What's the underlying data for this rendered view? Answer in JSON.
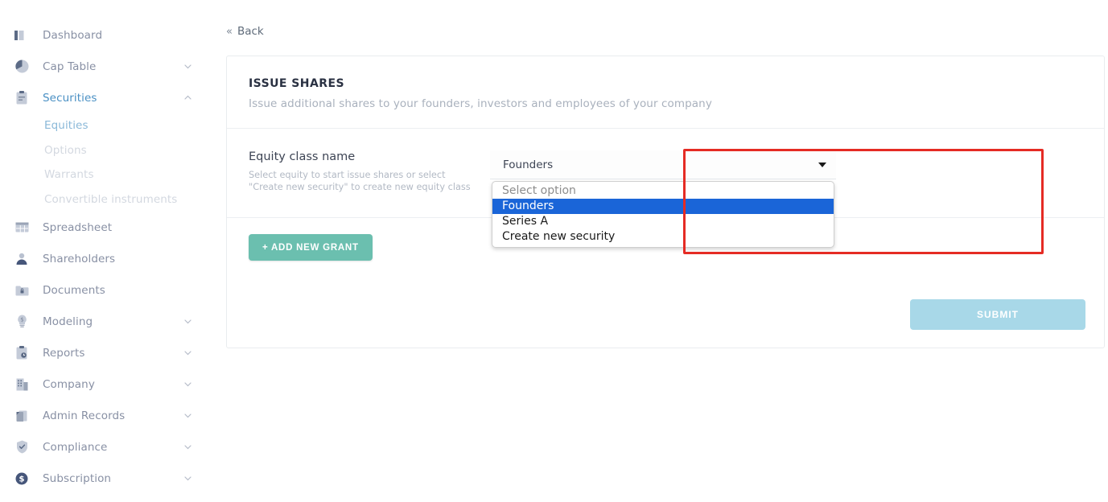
{
  "sidebar": {
    "items": [
      {
        "label": "Dashboard",
        "icon": "bar-chart-icon",
        "expandable": false,
        "active": false
      },
      {
        "label": "Cap Table",
        "icon": "pie-chart-icon",
        "expandable": true,
        "active": false
      },
      {
        "label": "Securities",
        "icon": "clipboard-icon",
        "expandable": true,
        "active": true
      },
      {
        "label": "Spreadsheet",
        "icon": "table-grid-icon",
        "expandable": false,
        "active": false
      },
      {
        "label": "Shareholders",
        "icon": "person-icon",
        "expandable": false,
        "active": false
      },
      {
        "label": "Documents",
        "icon": "locked-folder-icon",
        "expandable": false,
        "active": false
      },
      {
        "label": "Modeling",
        "icon": "lightbulb-dollar-icon",
        "expandable": true,
        "active": false
      },
      {
        "label": "Reports",
        "icon": "clipboard-clock-icon",
        "expandable": true,
        "active": false
      },
      {
        "label": "Company",
        "icon": "building-icon",
        "expandable": true,
        "active": false
      },
      {
        "label": "Admin Records",
        "icon": "documents-icon",
        "expandable": true,
        "active": false
      },
      {
        "label": "Compliance",
        "icon": "shield-check-icon",
        "expandable": true,
        "active": false
      },
      {
        "label": "Subscription",
        "icon": "dollar-circle-icon",
        "expandable": true,
        "active": false
      }
    ],
    "securities_subitems": [
      {
        "label": "Equities",
        "selected": true
      },
      {
        "label": "Options",
        "selected": false
      },
      {
        "label": "Warrants",
        "selected": false
      },
      {
        "label": "Convertible instruments",
        "selected": false
      }
    ]
  },
  "main": {
    "back_label": "Back",
    "back_chevron": "«",
    "header": {
      "title": "ISSUE SHARES",
      "subtitle": "Issue additional shares to your founders, investors and employees of your company"
    },
    "field": {
      "title": "Equity class name",
      "help_line1": "Select equity to start issue shares or select",
      "help_line2": "\"Create new security\" to create new equity class",
      "selected_value": "Founders",
      "options": [
        {
          "label": "Select option",
          "state": "placeholder"
        },
        {
          "label": "Founders",
          "state": "highlighted"
        },
        {
          "label": "Series A",
          "state": "normal"
        },
        {
          "label": "Create new security",
          "state": "normal"
        }
      ]
    },
    "add_grant_label": "+ ADD NEW GRANT",
    "submit_label": "SUBMIT"
  },
  "colors": {
    "accent_teal": "#6bbfaf",
    "submit_blue": "#a8d8e8",
    "option_highlight": "#1a65d8",
    "annotation_red": "#e52b24",
    "active_nav": "#4a90c4",
    "selected_subnav": "#8ab8d8"
  }
}
